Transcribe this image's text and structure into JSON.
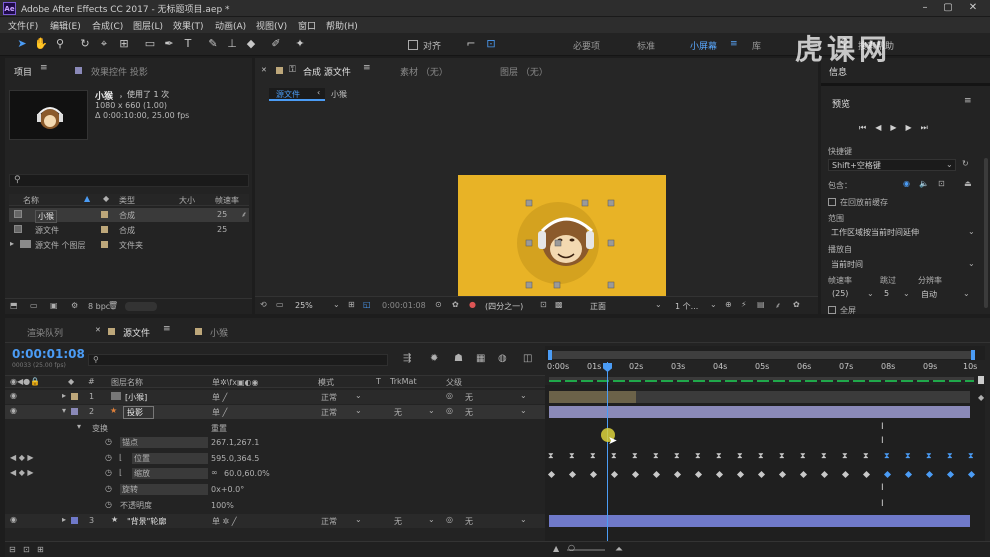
{
  "app": {
    "title": "Adobe After Effects CC 2017 - 无标题项目.aep *",
    "logo": "Ae"
  },
  "menu": [
    "文件(F)",
    "编辑(E)",
    "合成(C)",
    "图层(L)",
    "效果(T)",
    "动画(A)",
    "视图(V)",
    "窗口",
    "帮助(H)"
  ],
  "toolbar": {
    "snap_label": "对齐",
    "workspaces": [
      "必要项",
      "标准",
      "小屏幕",
      "库"
    ],
    "active_workspace": "小屏幕",
    "search_placeholder": "搜索帮助"
  },
  "project": {
    "tab": "项目",
    "tab2": "效果控件 投影",
    "item_name": "小猴",
    "item_used": "，使用了 1 次",
    "item_size": "1080 x 660 (1.00)",
    "item_duration": "Δ 0:00:10:00, 25.00 fps",
    "columns": {
      "name": "名称",
      "type": "类型",
      "size": "大小",
      "fps": "帧速率"
    },
    "items": [
      {
        "name": "小猴",
        "type": "合成",
        "fps": "25"
      },
      {
        "name": "源文件",
        "type": "合成",
        "fps": "25"
      },
      {
        "name": "源文件 个图层",
        "type": "文件夹",
        "fps": ""
      }
    ],
    "bpc": "8 bpc"
  },
  "viewer": {
    "tab": "合成 源文件",
    "footage_tab": "素材 （无）",
    "layer_tab": "图层 （无）",
    "breadcrumb1": "源文件",
    "breadcrumb2": "小猴",
    "zoom": "25%",
    "timecode": "0:00:01:08",
    "resolution": "(四分之一)",
    "mode": "正面",
    "views": "1 个..."
  },
  "info_panel": {
    "info_tab": "信息",
    "preview_tab": "预览",
    "shortcut_label": "快捷键",
    "shortcut_value": "Shift+空格键",
    "include_label": "包含：",
    "cache_label": "在回放前缓存",
    "range_label": "范围",
    "range_value": "工作区域按当前时间延伸",
    "play_from_label": "播放自",
    "play_from_value": "当前时间",
    "framerate_label": "帧速率",
    "skip_label": "跳过",
    "resolution_label": "分辨率",
    "framerate_value": "(25)",
    "skip_value": "5",
    "resolution_value": "自动",
    "fullscreen_label": "全屏"
  },
  "timeline": {
    "tab_render": "渲染队列",
    "tab_comp": "源文件",
    "tab_comp2": "小猴",
    "timecode": "0:00:01:08",
    "frame_sub": "00033 (25.00 fps)",
    "columns": {
      "layer_name": "图层名称",
      "mode": "模式",
      "trkmat": "TrkMat",
      "parent": "父级"
    },
    "layers": [
      {
        "num": "1",
        "name": "[小猴]",
        "mode": "正常",
        "trkmat": "",
        "parent": "无"
      },
      {
        "num": "2",
        "name": "投影",
        "mode": "正常",
        "trkmat": "无",
        "parent": "无"
      },
      {
        "num": "3",
        "name": "\"背景\"轮廓",
        "mode": "正常",
        "trkmat": "无",
        "parent": "无"
      }
    ],
    "transform_label": "变换",
    "reset_label": "重置",
    "props": [
      {
        "name": "锚点",
        "value": "267.1,267.1"
      },
      {
        "name": "位置",
        "value": "595.0,364.5"
      },
      {
        "name": "缩放",
        "value": "60.0,60.0%"
      },
      {
        "name": "旋转",
        "value": "0x+0.0°"
      },
      {
        "name": "不透明度",
        "value": "100%"
      }
    ],
    "ruler": [
      "0:00s",
      "01s",
      "02s",
      "03s",
      "04s",
      "05s",
      "06s",
      "07s",
      "08s",
      "09s",
      "10s"
    ]
  },
  "watermark": "虎课网",
  "colors": {
    "accent": "#4b9cf5",
    "comp_bg": "#e8b326",
    "layer_bar": "#8a89b8"
  }
}
